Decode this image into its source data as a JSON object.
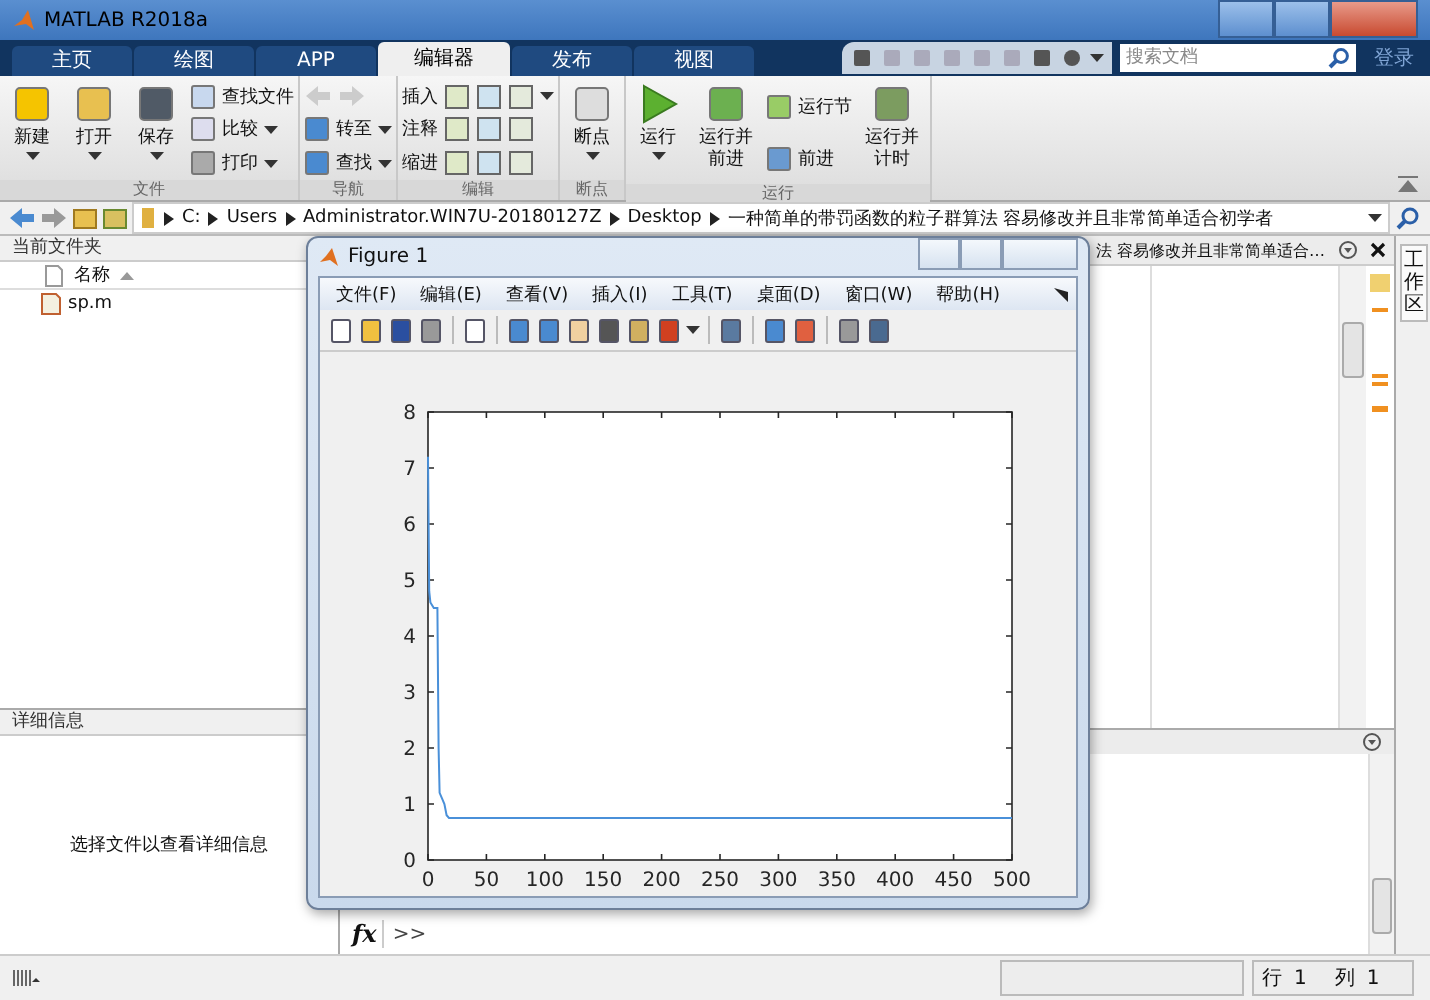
{
  "window": {
    "title": "MATLAB R2018a"
  },
  "ribbon_tabs": [
    {
      "label": "主页",
      "selected": false
    },
    {
      "label": "绘图",
      "selected": false
    },
    {
      "label": "APP",
      "selected": false
    },
    {
      "label": "编辑器",
      "selected": true
    },
    {
      "label": "发布",
      "selected": false
    },
    {
      "label": "视图",
      "selected": false
    }
  ],
  "search": {
    "placeholder": "搜索文档"
  },
  "sign_in": "登录",
  "ribbon_groups": [
    {
      "title": "文件",
      "items": [
        {
          "kind": "large",
          "label": "新建",
          "dropdown": true
        },
        {
          "kind": "large",
          "label": "打开",
          "dropdown": true
        },
        {
          "kind": "large",
          "label": "保存",
          "dropdown": true
        },
        {
          "kind": "stack",
          "rows": [
            {
              "kind": "button",
              "label": "查找文件",
              "dropdown": false
            },
            {
              "kind": "button",
              "label": "比较",
              "dropdown": true
            },
            {
              "kind": "button",
              "label": "打印",
              "dropdown": true
            }
          ]
        }
      ]
    },
    {
      "title": "导航",
      "items": [
        {
          "kind": "stack",
          "rows": [
            {
              "kind": "arrows"
            },
            {
              "kind": "button",
              "label": "转至",
              "dropdown": true
            },
            {
              "kind": "button",
              "label": "查找",
              "dropdown": true
            }
          ]
        }
      ]
    },
    {
      "title": "编辑",
      "items": [
        {
          "kind": "stack",
          "rows": [
            {
              "kind": "label_icons",
              "label": "插入",
              "dropdown": true
            },
            {
              "kind": "label_icons",
              "label": "注释"
            },
            {
              "kind": "label_icons",
              "label": "缩进"
            }
          ]
        }
      ]
    },
    {
      "title": "断点",
      "items": [
        {
          "kind": "large",
          "label": "断点",
          "dropdown": true
        }
      ]
    },
    {
      "title": "运行",
      "items": [
        {
          "kind": "large",
          "label": "运行",
          "dropdown": true
        },
        {
          "kind": "large",
          "label": "运行并前进",
          "dropdown": false
        },
        {
          "kind": "stack",
          "rows": [
            {
              "kind": "button",
              "label": "运行节",
              "dropdown": false
            },
            {
              "kind": "button",
              "label": "前进",
              "dropdown": false
            }
          ]
        },
        {
          "kind": "large",
          "label": "运行并计时",
          "dropdown": false
        }
      ]
    }
  ],
  "address_path": [
    "C:",
    "Users",
    "Administrator.WIN7U-20180127Z",
    "Desktop",
    "一种简单的带罚函数的粒子群算法 容易修改并且非常简单适合初学者"
  ],
  "current_folder": {
    "title": "当前文件夹",
    "column": "名称",
    "files": [
      {
        "name": "sp.m"
      }
    ]
  },
  "details": {
    "title": "详细信息",
    "message": "选择文件以查看详细信息"
  },
  "editor": {
    "tab_title": "法 容易修改并且非常简单适合…"
  },
  "workspace_tab": "工作区",
  "command_window": {
    "fx": "fx",
    "prompt": ">>"
  },
  "status_bar": {
    "row_label": "行",
    "row": "1",
    "col_label": "列",
    "col": "1"
  },
  "figure": {
    "title": "Figure 1",
    "menus": [
      "文件(F)",
      "编辑(E)",
      "查看(V)",
      "插入(I)",
      "工具(T)",
      "桌面(D)",
      "窗口(W)",
      "帮助(H)"
    ],
    "chart_data": {
      "type": "line",
      "x": [
        0,
        1,
        2,
        5,
        8,
        9,
        10,
        12,
        14,
        16,
        18,
        500
      ],
      "series": [
        {
          "color": "#4a90d9",
          "values": [
            7.2,
            4.8,
            4.6,
            4.5,
            4.5,
            2.0,
            1.2,
            1.1,
            1.0,
            0.8,
            0.75,
            0.75
          ]
        }
      ],
      "xlim": [
        0,
        500
      ],
      "ylim": [
        0,
        8
      ],
      "xticks": [
        0,
        50,
        100,
        150,
        200,
        250,
        300,
        350,
        400,
        450,
        500
      ],
      "yticks": [
        0,
        1,
        2,
        3,
        4,
        5,
        6,
        7,
        8
      ]
    }
  }
}
